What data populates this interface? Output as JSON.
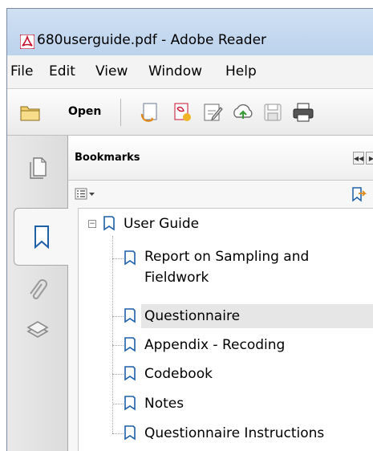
{
  "window": {
    "title": "680userguide.pdf - Adobe Reader",
    "app_icon": "adobe-reader-icon"
  },
  "menubar": {
    "items": [
      "File",
      "Edit",
      "View",
      "Window",
      "Help"
    ]
  },
  "toolbar": {
    "open_label": "Open",
    "icons": [
      "folder-open-icon",
      "create-pdf-icon",
      "export-pdf-icon",
      "sign-icon",
      "upload-cloud-icon",
      "save-icon",
      "print-icon"
    ]
  },
  "nav_pane": {
    "tabs": [
      {
        "icon": "pages-icon",
        "active": false
      },
      {
        "icon": "bookmark-icon",
        "active": true
      },
      {
        "icon": "paperclip-icon",
        "active": false
      },
      {
        "icon": "layers-icon",
        "active": false
      }
    ]
  },
  "bookmarks_panel": {
    "title": "Bookmarks",
    "options_icon": "options-menu-icon",
    "expand_icon": "expand-bookmark-icon",
    "root": {
      "label": "User Guide",
      "expanded": true
    },
    "items": [
      {
        "label_line1": "Report on Sampling and",
        "label_line2": "Fieldwork",
        "selected": false
      },
      {
        "label_line1": "Questionnaire",
        "selected": true
      },
      {
        "label_line1": "Appendix - Recoding",
        "selected": false
      },
      {
        "label_line1": "Codebook",
        "selected": false
      },
      {
        "label_line1": "Notes",
        "selected": false
      },
      {
        "label_line1": "Questionnaire Instructions",
        "selected": false
      }
    ]
  },
  "colors": {
    "titlebar": "#cfe0f3",
    "adobe_red": "#c8102e",
    "bookmark_blue": "#1e5fa8",
    "selection": "#e6e6e6"
  }
}
